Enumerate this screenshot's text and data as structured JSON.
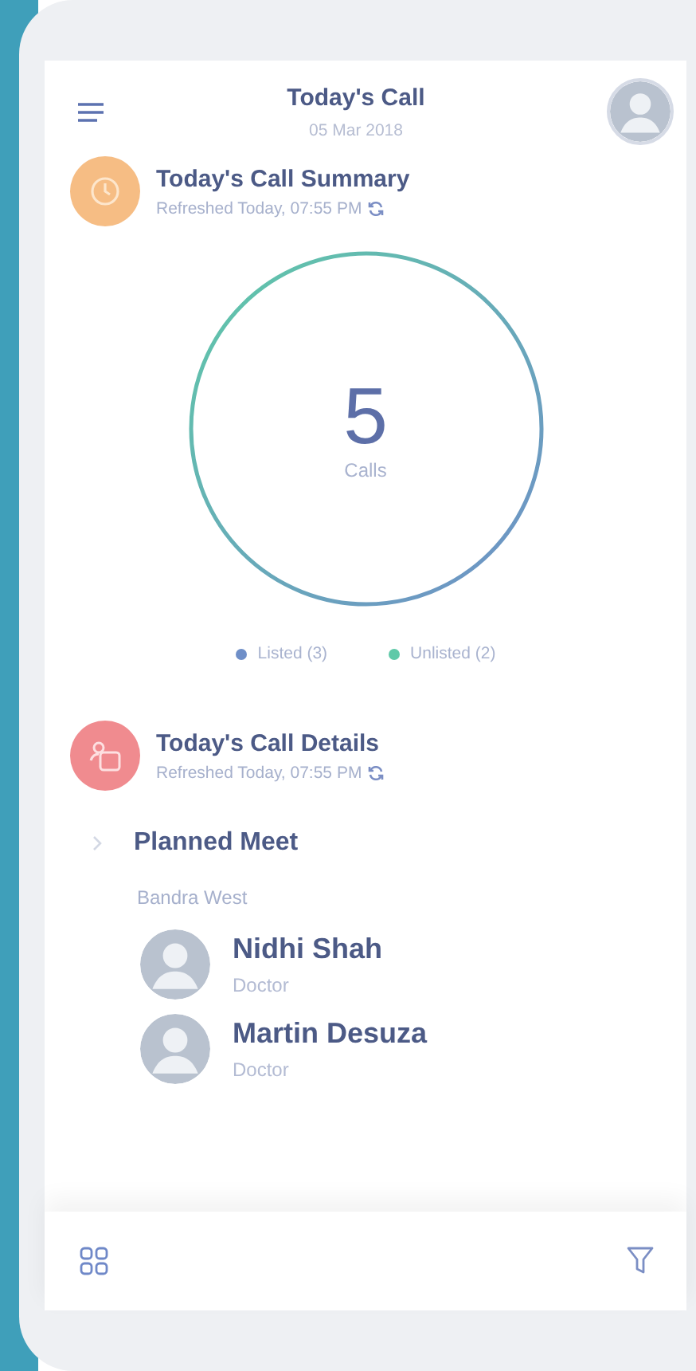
{
  "header": {
    "title": "Today's Call",
    "date": "05 Mar 2018"
  },
  "summary": {
    "title": "Today's Call Summary",
    "refreshed": "Refreshed Today, 07:55 PM"
  },
  "calls": {
    "count": "5",
    "unit": "Calls"
  },
  "legend": [
    {
      "label": "Listed (3)",
      "color": "#6f8fc8"
    },
    {
      "label": "Unlisted (2)",
      "color": "#5fc9a8"
    }
  ],
  "details": {
    "title": "Today's Call Details",
    "refreshed": "Refreshed Today, 07:55 PM"
  },
  "group": {
    "title": "Planned Meet",
    "location": "Bandra West"
  },
  "contacts": [
    {
      "name": "Nidhi Shah",
      "role": "Doctor"
    },
    {
      "name": "Martin Desuza",
      "role": "Doctor"
    }
  ]
}
